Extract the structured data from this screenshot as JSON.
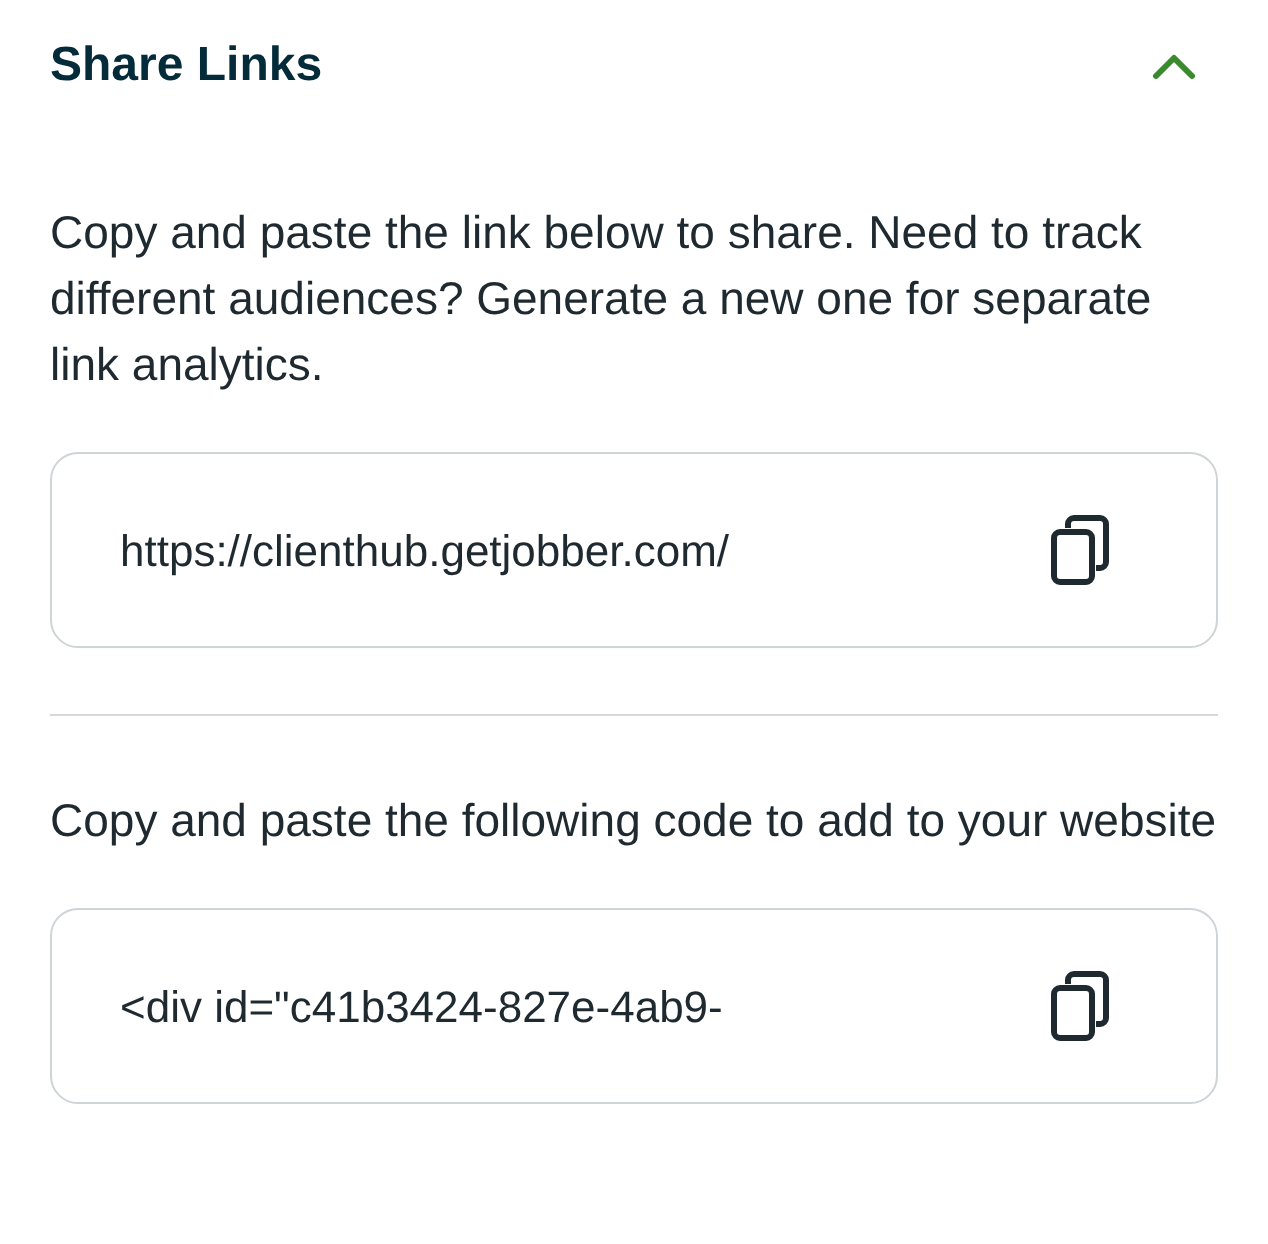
{
  "section": {
    "title": "Share Links",
    "expanded": true
  },
  "blocks": [
    {
      "description": "Copy and paste the link below to share. Need to track different audiences? Generate a new one for separate link analytics.",
      "value": "https://clienthub.getjobber.com/"
    },
    {
      "description": "Copy and paste the following code to add to your website",
      "value": "<div id=\"c41b3424-827e-4ab9-"
    }
  ]
}
